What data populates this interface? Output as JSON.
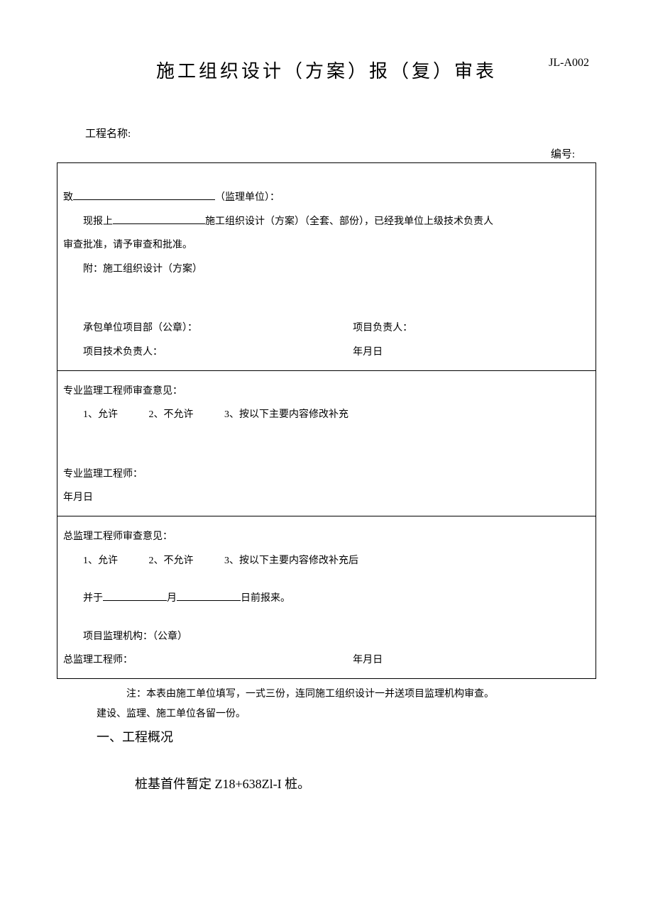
{
  "header": {
    "title": "施工组织设计（方案）报（复）审表",
    "formCode": "JL-A002"
  },
  "meta": {
    "projectNameLabel": "工程名称:",
    "serialLabel": "编号:"
  },
  "section1": {
    "toPrefix": "致",
    "toSuffix": "（监理单位）：",
    "submitPrefix": "现报上",
    "submitSuffix": "施工组织设计（方案）（全套、部份），已经我单位上级技术负责人",
    "submitLine2": "审查批准，请予审查和批准。",
    "attachment": "附：施工组织设计（方案）",
    "contractorSeal": "承包单位项目部（公章）：",
    "projectLeader": "项目负责人：",
    "techLeader": "项目技术负责人：",
    "dateLabel": "年月日"
  },
  "section2": {
    "heading": "专业监理工程师审查意见：",
    "opt1": "1、允许",
    "opt2": "2、不允许",
    "opt3": "3、按以下主要内容修改补充",
    "engineerLabel": "专业监理工程师：",
    "dateLabel": "年月日"
  },
  "section3": {
    "heading": "总监理工程师审查意见：",
    "opt1": "1、允许",
    "opt2": "2、不允许",
    "opt3": "3、按以下主要内容修改补充后",
    "deadlinePrefix": "并于",
    "deadlineMid": "月",
    "deadlineSuffix": "日前报来。",
    "orgSeal": "项目监理机构：（公章）",
    "chiefLabel": "总监理工程师：",
    "dateLabel": "年月日"
  },
  "notes": {
    "line1": "注：本表由施工单位填写，一式三份，连同施工组织设计一并送项目监理机构审查。",
    "line2": "建设、监理、施工单位各留一份。"
  },
  "body": {
    "sectionHeading": "一、工程概况",
    "paragraph": "桩基首件暂定 Z18+638Zl-I 桩。"
  }
}
